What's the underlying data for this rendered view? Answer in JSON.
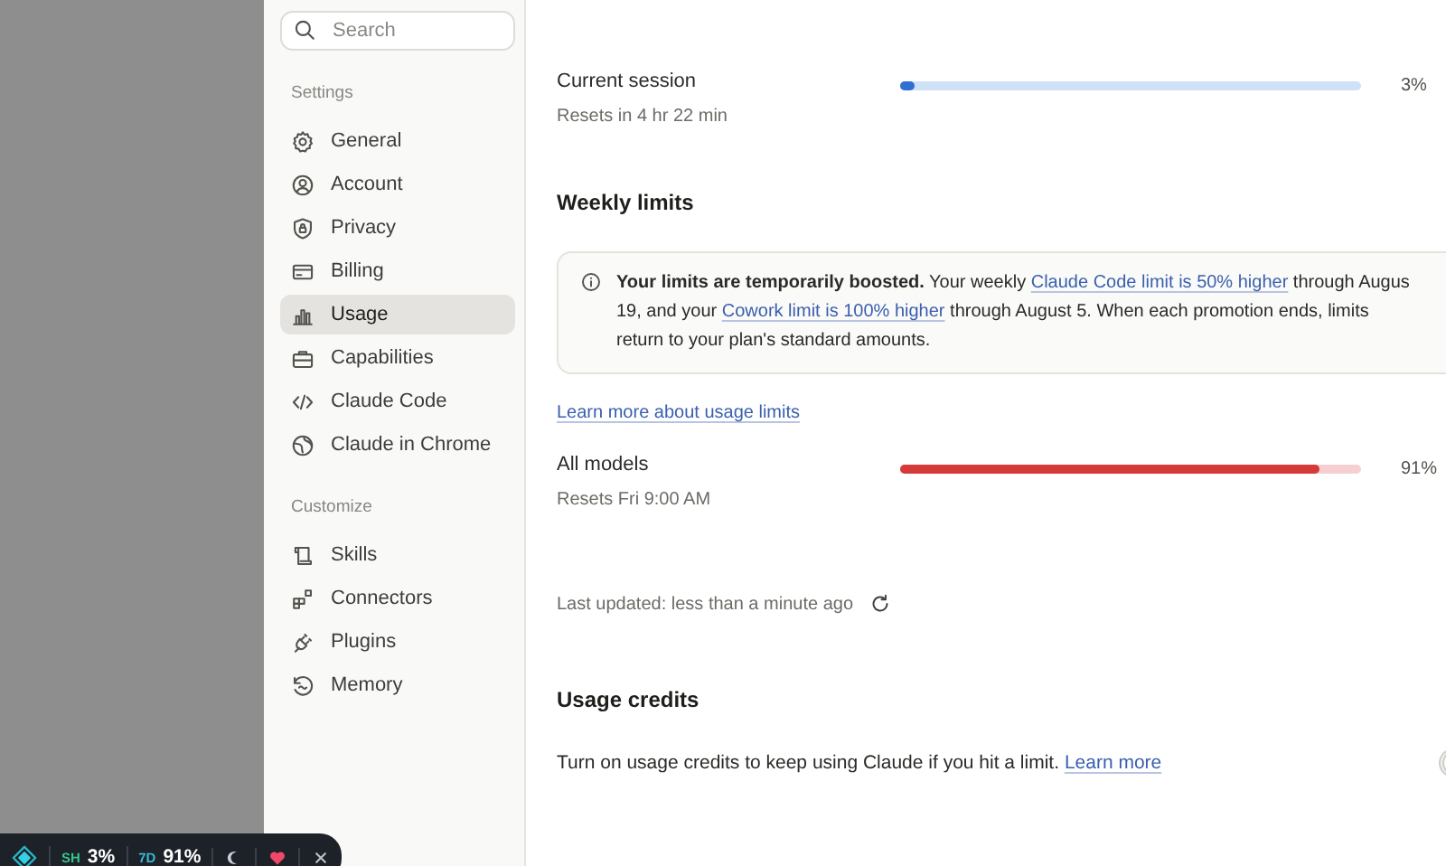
{
  "sidebar": {
    "search": {
      "placeholder": "Search"
    },
    "sections": [
      {
        "heading": "Settings",
        "items": [
          {
            "label": "General",
            "selected": false
          },
          {
            "label": "Account",
            "selected": false
          },
          {
            "label": "Privacy",
            "selected": false
          },
          {
            "label": "Billing",
            "selected": false
          },
          {
            "label": "Usage",
            "selected": true
          },
          {
            "label": "Capabilities",
            "selected": false
          },
          {
            "label": "Claude Code",
            "selected": false
          },
          {
            "label": "Claude in Chrome",
            "selected": false
          }
        ]
      },
      {
        "heading": "Customize",
        "items": [
          {
            "label": "Skills",
            "selected": false
          },
          {
            "label": "Connectors",
            "selected": false
          },
          {
            "label": "Plugins",
            "selected": false
          },
          {
            "label": "Memory",
            "selected": false
          }
        ]
      }
    ]
  },
  "current_session": {
    "title": "Current session",
    "subtitle": "Resets in 4 hr 22 min",
    "level": 0.03,
    "reading": "3%"
  },
  "weekly_limits": {
    "heading": "Weekly limits",
    "notice": [
      {
        "kind": "text",
        "text": "**Your limits are temporarily boosted.** Your weekly "
      },
      {
        "kind": "link",
        "text": "Claude Code limit is 50% higher"
      },
      {
        "kind": "text",
        "text": " through Augus 19, and your "
      },
      {
        "kind": "link",
        "text": "Cowork limit is 100% higher"
      },
      {
        "kind": "text",
        "text": " through August 5. When each promotion ends, limits return to your plan's standard amounts."
      }
    ],
    "link": "Learn more about usage limits",
    "meters": [
      {
        "title": "All models",
        "subtitle": "Resets Fri 9:00 AM",
        "level": 0.91,
        "reading": "91%"
      }
    ]
  },
  "last_updated": "Last updated: less than a minute ago",
  "usage_credits": {
    "heading": "Usage credits",
    "text": "Turn on usage credits to keep using Claude if you hit a limit. ",
    "link": "Learn more",
    "on": false
  },
  "widget": {
    "stats": [
      {
        "label": "SH",
        "value": "3%"
      },
      {
        "label": "7D",
        "value": "91%"
      }
    ]
  }
}
